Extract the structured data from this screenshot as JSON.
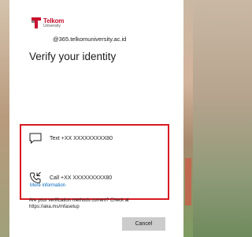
{
  "brand": {
    "logo_title": "Telkom",
    "logo_sub": "University",
    "accent_color": "#c8102e"
  },
  "account": "@365.telkomuniversity.ac.id",
  "title": "Verify your identity",
  "options": [
    {
      "icon": "message-icon",
      "label": "Text +XX XXXXXXXXX80"
    },
    {
      "icon": "phone-call-icon",
      "label": "Call +XX XXXXXXXXX80"
    }
  ],
  "more_info": "More information",
  "question": "Are your verification methods current? Check at https://aka.ms/mfasetup",
  "cancel_label": "Cancel",
  "highlight_color": "#d71a22"
}
